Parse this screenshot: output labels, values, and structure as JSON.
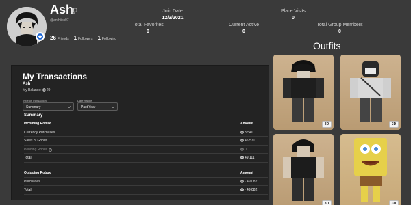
{
  "profile": {
    "display_name": "Ash",
    "handle": "@anthiixx07",
    "friends_count": "26",
    "friends_label": "Friends",
    "followers_count": "1",
    "followers_label": "Followers",
    "following_count": "1",
    "following_label": "Following"
  },
  "stats": {
    "join_date_label": "Join Date",
    "join_date_value": "12/3/2021",
    "place_visits_label": "Place Visits",
    "place_visits_value": "0",
    "total_favorites_label": "Total Favorites",
    "total_favorites_value": "0",
    "current_active_label": "Current Active",
    "current_active_value": "0",
    "total_group_members_label": "Total Group Members",
    "total_group_members_value": "0"
  },
  "outfits": {
    "title": "Outfits",
    "button_label": "3D"
  },
  "transactions": {
    "title": "My Transactions",
    "user": "Ash",
    "balance_label": "My Balance:",
    "balance_value": "29",
    "type_label": "Type of Transaction",
    "type_value": "Summary",
    "date_label": "Date Range",
    "date_value": "Past Year",
    "summary_title": "Summary",
    "incoming": {
      "header": "Incoming Robux",
      "amount_header": "Amount",
      "rows": [
        {
          "label": "Currency Purchases",
          "amount": "3,540"
        },
        {
          "label": "Sales of Goods",
          "amount": "45,571"
        },
        {
          "label": "Pending Robux",
          "amount": "0"
        },
        {
          "label": "Total",
          "amount": "49,111"
        }
      ]
    },
    "outgoing": {
      "header": "Outgoing Robux",
      "amount_header": "Amount",
      "rows": [
        {
          "label": "Purchases",
          "amount": "- 49,082"
        },
        {
          "label": "Total",
          "amount": "- 49,082"
        }
      ]
    }
  },
  "colors": {
    "background": "#3a3a3a",
    "panel": "#232323",
    "premium_badge": "#1c66d6"
  }
}
